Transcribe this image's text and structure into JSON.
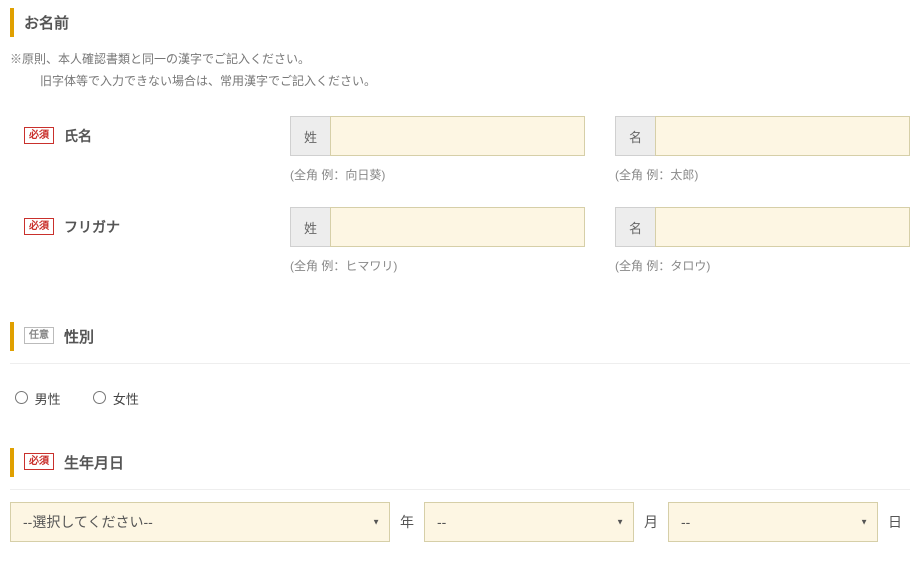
{
  "section_name": {
    "title": "お名前",
    "note1": "※原則、本人確認書類と同一の漢字でご記入ください。",
    "note2": "旧字体等で入力できない場合は、常用漢字でご記入ください。",
    "fields": {
      "shimei": {
        "badge": "必須",
        "label": "氏名",
        "sei_prefix": "姓",
        "mei_prefix": "名",
        "sei_hint": "(全角 例：向日葵)",
        "mei_hint": "(全角 例：太郎)"
      },
      "furigana": {
        "badge": "必須",
        "label": "フリガナ",
        "sei_prefix": "姓",
        "mei_prefix": "名",
        "sei_hint": "(全角 例：ヒマワリ)",
        "mei_hint": "(全角 例：タロウ)"
      }
    }
  },
  "section_gender": {
    "badge": "任意",
    "title": "性別",
    "option_male": "男性",
    "option_female": "女性"
  },
  "section_dob": {
    "badge": "必須",
    "title": "生年月日",
    "era_placeholder": "--選択してください--",
    "year_unit": "年",
    "month_placeholder": "--",
    "month_unit": "月",
    "day_placeholder": "--",
    "day_unit": "日"
  }
}
